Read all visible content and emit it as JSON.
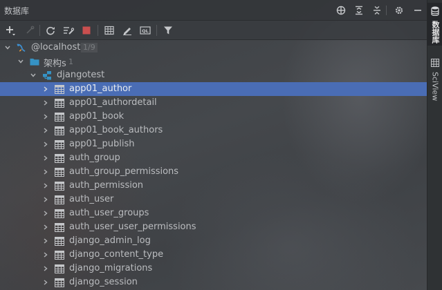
{
  "header": {
    "title": "数据库"
  },
  "tree": {
    "host": {
      "label": "@localhost",
      "badge": "1/9"
    },
    "schemas": {
      "label": "架构s",
      "count": "1"
    },
    "database": {
      "label": "djangotest"
    },
    "tables": [
      "app01_author",
      "app01_authordetail",
      "app01_book",
      "app01_book_authors",
      "app01_publish",
      "auth_group",
      "auth_group_permissions",
      "auth_permission",
      "auth_user",
      "auth_user_groups",
      "auth_user_user_permissions",
      "django_admin_log",
      "django_content_type",
      "django_migrations",
      "django_session"
    ],
    "selected": "app01_author"
  },
  "sidebar": {
    "tabs": [
      {
        "label": "数据库",
        "icon": "database-icon",
        "active": true
      },
      {
        "label": "SciView",
        "icon": "sciview-icon",
        "active": false
      }
    ]
  },
  "colors": {
    "selection": "#4a6db5",
    "stop": "#c94f4f",
    "schema_folder": "#3592c4",
    "host_icon": "#3d8fd1"
  }
}
